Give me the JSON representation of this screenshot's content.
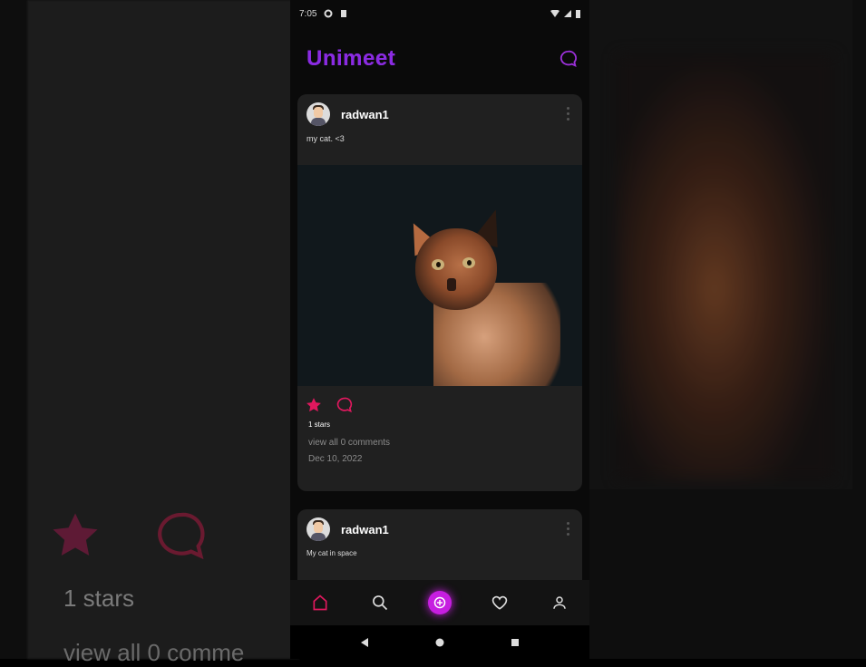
{
  "status": {
    "time": "7:05"
  },
  "app": {
    "title": "Unimeet"
  },
  "posts": [
    {
      "username": "radwan1",
      "caption": "my cat. <3",
      "stars": "1 stars",
      "comments": "view all 0 comments",
      "date": "Dec 10, 2022"
    },
    {
      "username": "radwan1",
      "caption": "My cat in space"
    }
  ],
  "backdrop": {
    "stars": "1 stars",
    "comments": "view all 0 comme"
  },
  "colors": {
    "accent": "#e0185e",
    "brand": "#8a2be2",
    "add_button": "#c61ee0"
  },
  "icons": {
    "chat": "chat-bubble-icon",
    "star": "star-icon",
    "home": "home-icon",
    "search": "search-icon",
    "add": "add-icon",
    "heart": "heart-icon",
    "profile": "profile-icon"
  }
}
